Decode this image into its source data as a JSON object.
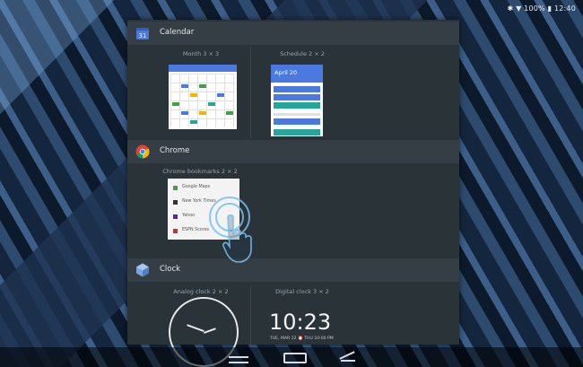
{
  "status_bar": {
    "text": "✱ ▼ 100% ▮ 12:40"
  },
  "apps": [
    {
      "name": "Calendar",
      "widgets": [
        {
          "label": "Month 3 × 3"
        },
        {
          "label": "Schedule 2 × 2",
          "date": "April 20"
        }
      ]
    },
    {
      "name": "Chrome",
      "widgets": [
        {
          "label": "Chrome bookmarks 2 × 2",
          "bookmarks": [
            "Google Maps",
            "New York Times",
            "Yahoo",
            "ESPN Scores"
          ]
        }
      ]
    },
    {
      "name": "Clock",
      "widgets": [
        {
          "label": "Analog clock 2 × 2"
        },
        {
          "label": "Digital clock 3 × 2",
          "time": "10:23",
          "date": "TUE, MAR 22 ⏰ THU 10:00 PM"
        }
      ]
    }
  ],
  "colors": {
    "panel_bg": "#2a3338",
    "header_bg": "#353e44",
    "accent": "#35b7c8",
    "calendar_blue": "#4a7ae0"
  },
  "icons": [
    "calendar-icon",
    "chrome-icon",
    "clock-icon",
    "touch-hand-icon",
    "back-icon",
    "home-icon",
    "recents-icon"
  ]
}
